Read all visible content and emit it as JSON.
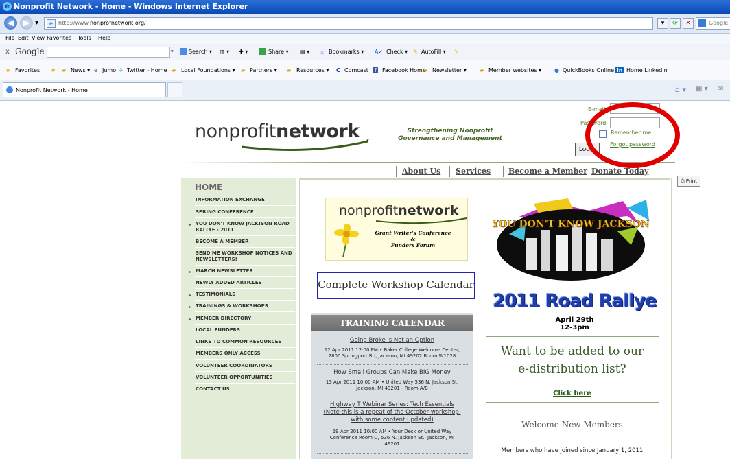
{
  "window": {
    "title": "Nonprofit Network - Home - Windows Internet Explorer"
  },
  "browser": {
    "url_prefix": "http://www.",
    "url_domain": "nonprofnetwork.org/",
    "search_engine_label": "Google",
    "menu": [
      "File",
      "Edit",
      "View",
      "Favorites",
      "Tools",
      "Help"
    ],
    "google_toolbar": {
      "close": "x",
      "logo": "Google",
      "search_label": "Search ▾",
      "share_label": "Share ▾",
      "bookmarks_label": "Bookmarks ▾",
      "check_label": "Check ▾",
      "autofill_label": "AutoFill ▾"
    },
    "favorites": [
      "Favorites",
      "News ▾",
      "Jumo",
      "Twitter - Home",
      "Local Foundations ▾",
      "Partners ▾",
      "Resources ▾",
      "Comcast",
      "Facebook Home",
      "Newsletter ▾",
      "Member websites ▾",
      "QuickBooks Online",
      "Home LinkedIn"
    ],
    "tab_title": "Nonprofit Network - Home"
  },
  "site": {
    "logo_light": "nonprofit",
    "logo_bold": "network",
    "tagline_line1": "Strengthening Nonprofit",
    "tagline_line2": "Governance and Management"
  },
  "login": {
    "email_label": "E-mail",
    "password_label": "Password",
    "remember_label": "Remember me",
    "login_button": "Login",
    "forgot_link": "Forgot password"
  },
  "top_nav": [
    "About Us",
    "Services",
    "Become a Member",
    "Donate Today"
  ],
  "print_label": "Print",
  "sidebar": {
    "home": "HOME",
    "items": [
      {
        "label": "INFORMATION EXCHANGE"
      },
      {
        "label": "SPRING CONFERENCE"
      },
      {
        "label": "YOU DON'T KNOW JACK!SON ROAD RALLYE - 2011"
      },
      {
        "label": "BECOME A MEMBER"
      },
      {
        "label": "SEND ME WORKSHOP NOTICES AND NEWSLETTERS!"
      },
      {
        "label": "MARCH NEWSLETTER"
      },
      {
        "label": "NEWLY ADDED ARTICLES"
      },
      {
        "label": "TESTIMONIALS"
      },
      {
        "label": "TRAININGS & WORKSHOPS"
      },
      {
        "label": "MEMBER DIRECTORY"
      },
      {
        "label": "LOCAL FUNDERS"
      },
      {
        "label": "LINKS TO COMMON RESOURCES"
      },
      {
        "label": "MEMBERS ONLY ACCESS"
      },
      {
        "label": "VOLUNTEER COORDINATORS"
      },
      {
        "label": "VOLUNTEER OPPORTUNITIES"
      },
      {
        "label": "CONTACT US"
      }
    ]
  },
  "main": {
    "grant_logo_light": "nonprofit",
    "grant_logo_bold": "network",
    "grant_sub1": "Grant Writer's Conference",
    "grant_sub2": "&",
    "grant_sub3": "Funders Forum",
    "calendar_link": "Complete Workshop Calendar",
    "training_title": "TRAINING CALENDAR",
    "events": [
      {
        "title": "Going Broke is Not an Option",
        "desc1": "12 Apr 2011 12:00 PM • Baker College Welcome Center,",
        "desc2": "2800 Springport Rd, Jackson, MI 49202 Room W1028"
      },
      {
        "title": "How Small Groups Can Make BIG Money",
        "desc1": "13 Apr 2011 10:00 AM • United Way 536 N. Jackson St,",
        "desc2": "Jackson, MI 49201 - Room A/B"
      },
      {
        "title1": "Highway T Webinar Series: Tech Essentials",
        "title2": "(Note this is a repeat of the October workshop,",
        "title3": "with some content updated)",
        "desc1": "19 Apr 2011 10:00 AM • Your Desk or United Way",
        "desc2": "Conference Room D, 536 N. Jackson St., Jackson, MI",
        "desc3": "49201"
      }
    ],
    "rally_image_text": "YOU DON'T KNOW JACKSON",
    "rally_title": "2011 Road Rallye",
    "rally_date1": "April 29th",
    "rally_date2": "12-3pm",
    "want_line1": "Want to be added to our",
    "want_line2": "e-distribution list?",
    "click_here": "Click here",
    "welcome": "Welcome New Members",
    "since": "Members who have joined since January 1, 2011"
  }
}
